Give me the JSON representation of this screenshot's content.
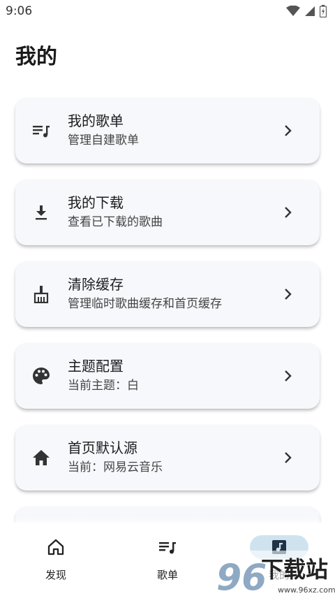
{
  "status_bar": {
    "time": "9:06"
  },
  "page_title": "我的",
  "cards": [
    {
      "icon": "playlist-music-icon",
      "title": "我的歌单",
      "subtitle": "管理自建歌单"
    },
    {
      "icon": "download-icon",
      "title": "我的下载",
      "subtitle": "查看已下载的歌曲"
    },
    {
      "icon": "broom-icon",
      "title": "清除缓存",
      "subtitle": "管理临时歌曲缓存和首页缓存"
    },
    {
      "icon": "palette-icon",
      "title": "主题配置",
      "subtitle": "当前主题：白"
    },
    {
      "icon": "home-icon",
      "title": "首页默认源",
      "subtitle": "当前：网易云音乐"
    }
  ],
  "bottom_nav": [
    {
      "icon": "home-outline-icon",
      "label": "发现"
    },
    {
      "icon": "playlist-music-icon",
      "label": "歌单"
    },
    {
      "icon": "music-box-icon",
      "label": "我的",
      "selected": true
    }
  ],
  "watermark": {
    "text": "下载站",
    "url": "www.96xz.com",
    "number": "96"
  }
}
